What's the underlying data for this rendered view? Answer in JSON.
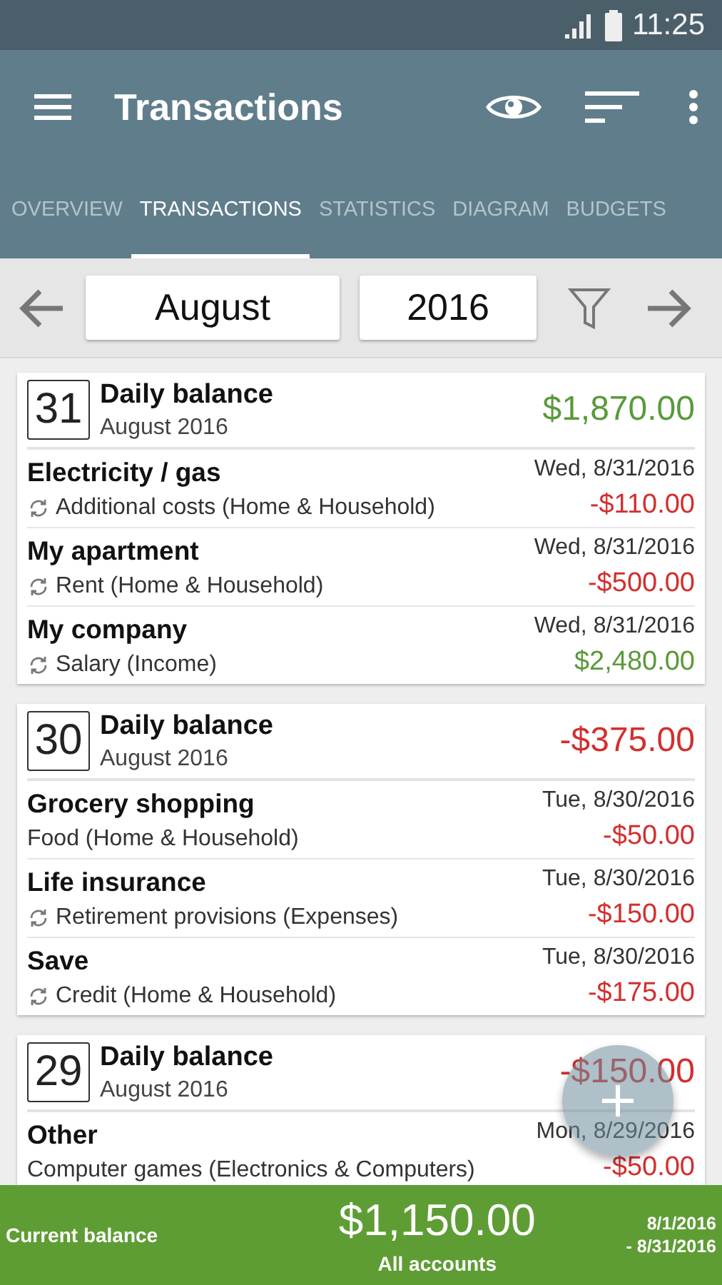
{
  "status_bar": {
    "time": "11:25"
  },
  "app_bar": {
    "title": "Transactions"
  },
  "tabs": [
    {
      "label": "OVERVIEW",
      "selected": false
    },
    {
      "label": "TRANSACTIONS",
      "selected": true
    },
    {
      "label": "STATISTICS",
      "selected": false
    },
    {
      "label": "DIAGRAM",
      "selected": false
    },
    {
      "label": "BUDGETS",
      "selected": false
    }
  ],
  "period": {
    "month": "August",
    "year": "2016"
  },
  "days": [
    {
      "day": "31",
      "title": "Daily balance",
      "subtitle": "August 2016",
      "balance": "$1,870.00",
      "kind": "income",
      "transactions": [
        {
          "name": "Electricity / gas",
          "category": "Additional costs (Home & Household)",
          "recurring": true,
          "date": "Wed, 8/31/2016",
          "amount": "-$110.00",
          "kind": "expense"
        },
        {
          "name": "My apartment",
          "category": "Rent (Home & Household)",
          "recurring": true,
          "date": "Wed, 8/31/2016",
          "amount": "-$500.00",
          "kind": "expense"
        },
        {
          "name": "My company",
          "category": "Salary (Income)",
          "recurring": true,
          "date": "Wed, 8/31/2016",
          "amount": "$2,480.00",
          "kind": "income"
        }
      ]
    },
    {
      "day": "30",
      "title": "Daily balance",
      "subtitle": "August 2016",
      "balance": "-$375.00",
      "kind": "expense",
      "transactions": [
        {
          "name": "Grocery shopping",
          "category": "Food (Home & Household)",
          "recurring": false,
          "date": "Tue, 8/30/2016",
          "amount": "-$50.00",
          "kind": "expense"
        },
        {
          "name": "Life insurance",
          "category": "Retirement provisions (Expenses)",
          "recurring": true,
          "date": "Tue, 8/30/2016",
          "amount": "-$150.00",
          "kind": "expense"
        },
        {
          "name": "Save",
          "category": "Credit (Home & Household)",
          "recurring": true,
          "date": "Tue, 8/30/2016",
          "amount": "-$175.00",
          "kind": "expense"
        }
      ]
    },
    {
      "day": "29",
      "title": "Daily balance",
      "subtitle": "August 2016",
      "balance": "-$150.00",
      "kind": "expense",
      "transactions": [
        {
          "name": "Other",
          "category": "Computer games (Electronics & Computers)",
          "recurring": false,
          "date": "Mon, 8/29/2016",
          "amount": "-$50.00",
          "kind": "expense"
        }
      ]
    }
  ],
  "footer": {
    "label": "Current balance",
    "balance": "$1,150.00",
    "accounts": "All accounts",
    "range_start": "8/1/2016",
    "range_end": "- 8/31/2016"
  }
}
